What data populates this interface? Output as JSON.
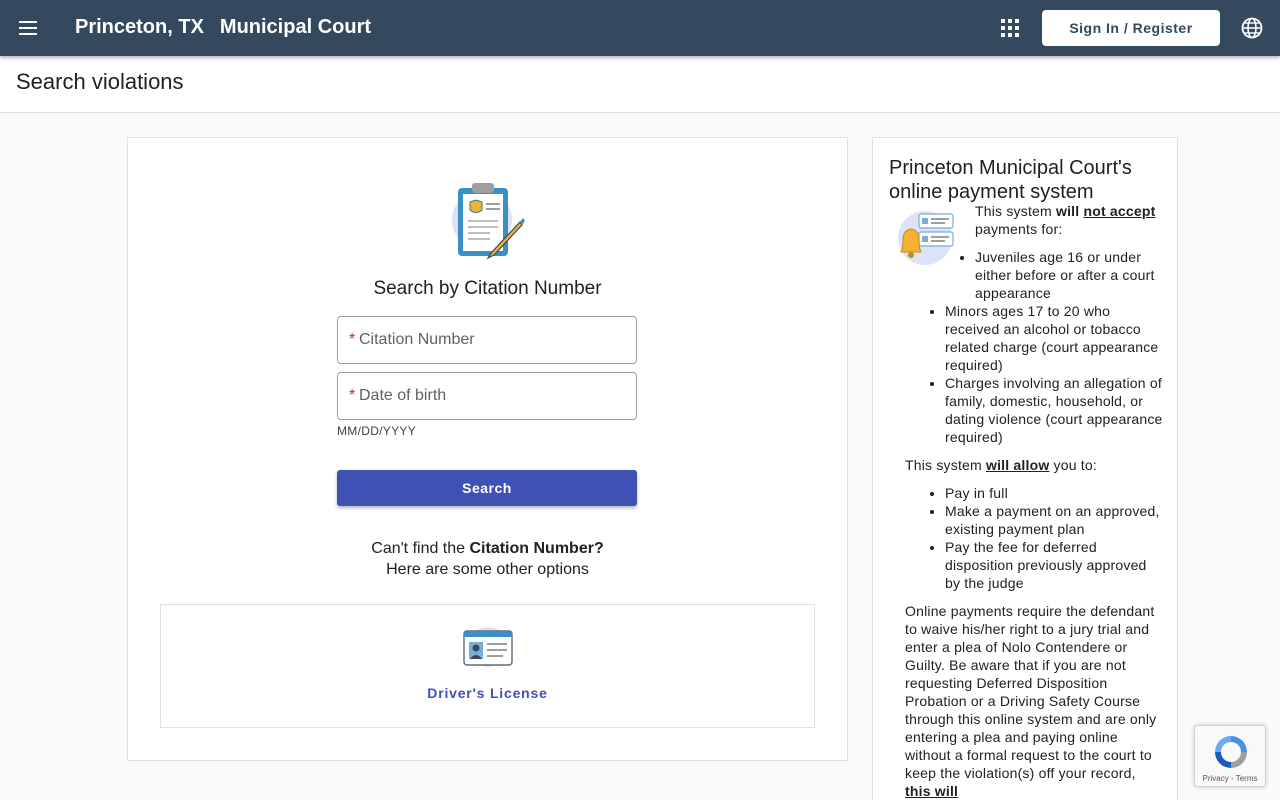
{
  "header": {
    "city": "Princeton, TX",
    "court": "Municipal Court",
    "signin_label": "Sign In / Register",
    "bg_color": "#34495e"
  },
  "page": {
    "title": "Search violations"
  },
  "search": {
    "title": "Search by Citation Number",
    "citation_placeholder": "Citation Number",
    "citation_value": "",
    "dob_placeholder": "Date of birth",
    "dob_value": "",
    "dob_hint": "MM/DD/YYYY",
    "button_label": "Search",
    "accent_color": "#3f51b5"
  },
  "alternatives": {
    "line1_prefix": "Can't find the",
    "line1_bold": "Citation Number?",
    "line2": "Here are some other options",
    "options": [
      {
        "label": "Driver's License",
        "icon": "id-card-icon"
      }
    ]
  },
  "info": {
    "title": "Princeton Municipal Court's online payment system",
    "not_accept_prefix": "This system",
    "not_accept_will": "will",
    "not_accept_emph": "not accept",
    "not_accept_suffix": "payments for:",
    "not_accept_items": [
      "Juveniles age 16 or under either before or after a court appearance",
      "Minors ages 17 to 20 who received an alcohol or tobacco related charge (court appearance required)",
      "Charges involving an allegation of family, domestic, household, or dating violence (court appearance required)"
    ],
    "allow_prefix": "This system",
    "allow_emph": "will allow",
    "allow_suffix": "you to:",
    "allow_items": [
      "Pay in full",
      "Make a payment on an approved, existing payment plan",
      "Pay the fee for deferred disposition previously approved by the judge"
    ],
    "waiver_text": "Online payments require the defendant to waive his/her right to a jury trial and enter a plea of Nolo Contendere or Guilty.  Be aware that if you are not requesting Deferred Disposition Probation or a Driving Safety Course through this online system and are only entering a plea and paying online without a formal request to the court to keep the violation(s) off your record,",
    "waiver_emph": "this will"
  },
  "recaptcha": {
    "links": "Privacy - Terms"
  }
}
